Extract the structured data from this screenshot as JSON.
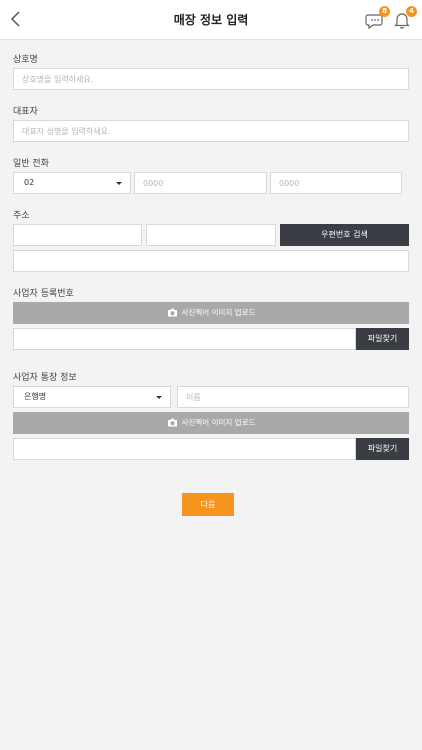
{
  "header": {
    "title": "매장 정보 입력",
    "chat_badge": "8",
    "bell_badge": "4"
  },
  "form": {
    "store_name": {
      "label": "상호명",
      "placeholder": "상호명을 입력하세요."
    },
    "owner": {
      "label": "대표자",
      "placeholder": "대표자 성명을 입력하세요."
    },
    "phone": {
      "label": "일반 전화",
      "area_code": "02",
      "middle_placeholder": "0000",
      "last_placeholder": "0000"
    },
    "address": {
      "label": "주소",
      "zip_button": "우편번호 검색"
    },
    "biz_reg": {
      "label": "사업자 등록번호",
      "upload_label": "사진찍어 이미지 업로드",
      "file_button": "파일찾기"
    },
    "bank": {
      "label": "사업자 통장 정보",
      "bank_select": "은행명",
      "name_placeholder": "이름",
      "upload_label": "사진찍어 이미지 업로드",
      "file_button": "파일찾기"
    }
  },
  "next_button": "다음",
  "colors": {
    "accent": "#f7941d",
    "dark_button": "#3a3d44",
    "upload_bar": "#a9a9a9",
    "background": "#f3f3f3"
  }
}
